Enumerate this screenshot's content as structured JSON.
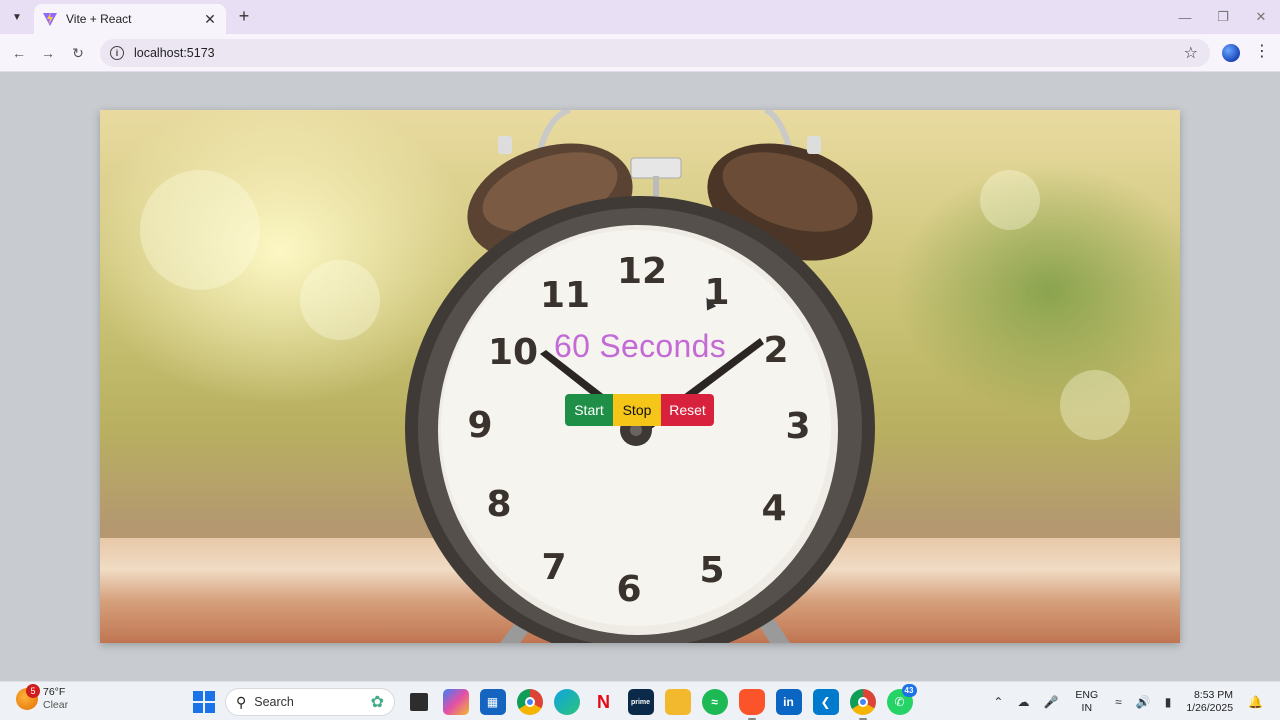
{
  "browser": {
    "tab_title": "Vite + React",
    "url": "localhost:5173",
    "icons": {
      "tab_list": "chevron-down-icon",
      "close_tab": "close-icon",
      "new_tab": "plus-icon",
      "back": "arrow-left-icon",
      "forward": "arrow-right-icon",
      "reload": "reload-icon",
      "site_info": "info-icon",
      "bookmark": "star-icon",
      "profile": "globe-icon",
      "menu": "more-vert-icon"
    }
  },
  "app": {
    "timer_text": "60 Seconds",
    "buttons": {
      "start": "Start",
      "stop": "Stop",
      "reset": "Reset"
    },
    "colors": {
      "timer_text": "#c46ad6",
      "start": "#1f8f47",
      "stop": "#f5c518",
      "reset": "#d8223d"
    },
    "clock_numerals": [
      "12",
      "1",
      "2",
      "3",
      "4",
      "5",
      "6",
      "7",
      "8",
      "9",
      "10",
      "11"
    ]
  },
  "taskbar": {
    "weather": {
      "temp": "76°F",
      "condition": "Clear",
      "badge": "5"
    },
    "search_placeholder": "Search",
    "apps": [
      "file-explorer-icon",
      "copilot-icon",
      "store-icon",
      "chrome-icon",
      "edge-icon",
      "netflix-icon",
      "prime-video-icon",
      "folder-icon",
      "spotify-icon",
      "brave-icon",
      "linkedin-icon",
      "vscode-icon",
      "chrome-profile-icon",
      "whatsapp-icon"
    ],
    "whatsapp_badge": "43",
    "language": {
      "line1": "ENG",
      "line2": "IN"
    },
    "time": "8:53 PM",
    "date": "1/26/2025"
  }
}
